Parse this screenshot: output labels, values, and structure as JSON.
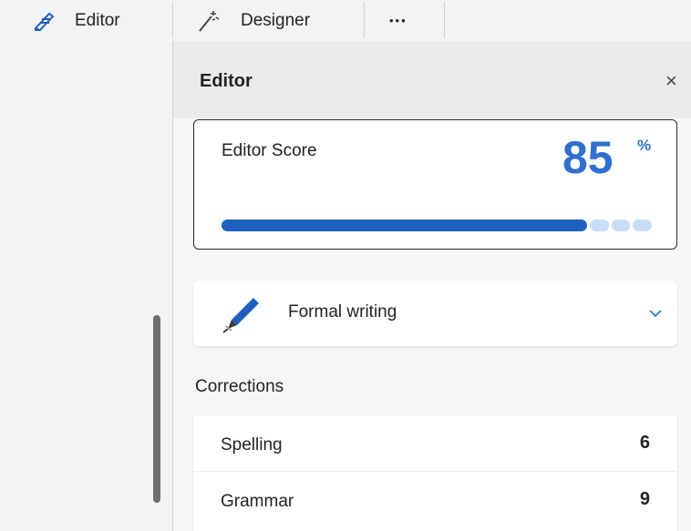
{
  "toolbar": {
    "editor_label": "Editor",
    "designer_label": "Designer",
    "more_label": "•••"
  },
  "panel": {
    "title": "Editor",
    "close_glyph": "×"
  },
  "score": {
    "label": "Editor Score",
    "value": "85",
    "unit": "%",
    "fraction": 0.85,
    "fill_color": "#1f5fbf",
    "remaining_color": "#c9dcf7",
    "value_color": "#2f6fd0"
  },
  "writing_style": {
    "label": "Formal writing",
    "icon": "fountain-pen-icon"
  },
  "corrections": {
    "title": "Corrections",
    "items": [
      {
        "label": "Spelling",
        "count": "6"
      },
      {
        "label": "Grammar",
        "count": "9"
      }
    ]
  }
}
